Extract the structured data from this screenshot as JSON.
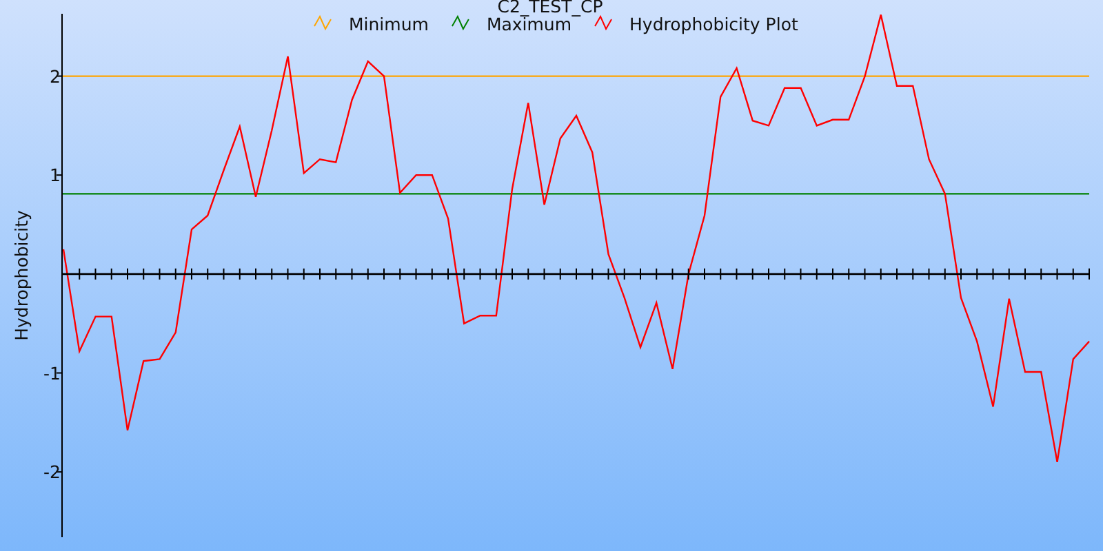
{
  "chart_data": {
    "type": "line",
    "title": "C2_TEST_CP",
    "ylabel": "Hydrophobicity",
    "ylim": [
      -2.66,
      2.63
    ],
    "yticks": [
      -2,
      -1,
      1,
      2
    ],
    "legend": true,
    "series": [
      {
        "name": "Minimum",
        "color": "#ffa500",
        "values": [
          2,
          2,
          2,
          2,
          2,
          2,
          2,
          2,
          2,
          2,
          2,
          2,
          2,
          2,
          2,
          2,
          2,
          2,
          2,
          2,
          2,
          2,
          2,
          2,
          2,
          2,
          2,
          2,
          2,
          2,
          2,
          2,
          2,
          2,
          2,
          2,
          2,
          2,
          2,
          2,
          2,
          2,
          2,
          2,
          2,
          2,
          2,
          2,
          2,
          2,
          2,
          2,
          2,
          2,
          2,
          2,
          2,
          2,
          2,
          2,
          2,
          2,
          2,
          2,
          2
        ]
      },
      {
        "name": "Maximum",
        "color": "#008000",
        "values": [
          0.81,
          0.81,
          0.81,
          0.81,
          0.81,
          0.81,
          0.81,
          0.81,
          0.81,
          0.81,
          0.81,
          0.81,
          0.81,
          0.81,
          0.81,
          0.81,
          0.81,
          0.81,
          0.81,
          0.81,
          0.81,
          0.81,
          0.81,
          0.81,
          0.81,
          0.81,
          0.81,
          0.81,
          0.81,
          0.81,
          0.81,
          0.81,
          0.81,
          0.81,
          0.81,
          0.81,
          0.81,
          0.81,
          0.81,
          0.81,
          0.81,
          0.81,
          0.81,
          0.81,
          0.81,
          0.81,
          0.81,
          0.81,
          0.81,
          0.81,
          0.81,
          0.81,
          0.81,
          0.81,
          0.81,
          0.81,
          0.81,
          0.81,
          0.81,
          0.81,
          0.81,
          0.81,
          0.81,
          0.81,
          0.81
        ]
      },
      {
        "name": "Hydrophobicity Plot",
        "color": "#ff0000",
        "values": [
          0.25,
          -0.78,
          -0.43,
          -0.43,
          -1.58,
          -0.88,
          -0.86,
          -0.59,
          0.45,
          0.59,
          1.05,
          1.49,
          0.78,
          1.45,
          2.2,
          1.02,
          1.16,
          1.13,
          1.76,
          2.15,
          2.0,
          0.82,
          1.0,
          1.0,
          0.56,
          -0.5,
          -0.42,
          -0.42,
          0.86,
          1.73,
          0.7,
          1.37,
          1.6,
          1.23,
          0.2,
          -0.24,
          -0.74,
          -0.29,
          -0.96,
          0,
          0.59,
          1.79,
          2.08,
          1.55,
          1.5,
          1.88,
          1.88,
          1.5,
          1.56,
          1.56,
          2.0,
          2.62,
          1.9,
          1.9,
          1.16,
          0.81,
          -0.24,
          -0.68,
          -1.34,
          -0.25,
          -0.99,
          -0.99,
          -1.9,
          -0.86,
          -0.68
        ]
      }
    ]
  }
}
